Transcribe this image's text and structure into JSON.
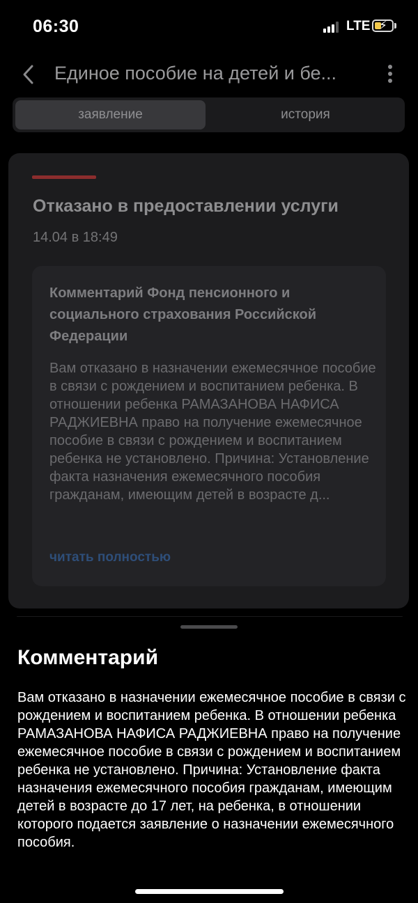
{
  "status_bar": {
    "time": "06:30",
    "network": "LTE",
    "signal_bars": 3,
    "battery_charging": true
  },
  "header": {
    "title": "Единое пособие на детей и бе...",
    "back_icon": "chevron-left-icon",
    "menu_icon": "more-vertical-icon"
  },
  "tabs": [
    {
      "label": "заявление",
      "active": true
    },
    {
      "label": "история",
      "active": false
    }
  ],
  "status_card": {
    "accent_color": "#8b2d2d",
    "title": "Отказано в предоставлении услуги",
    "date": "14.04 в 18:49",
    "comment": {
      "heading": "Комментарий Фонд пенсионного и социального страхования Российской Федерации",
      "text": "Вам отказано в назначении ежемесячное пособие в связи с рождением и воспитанием ребенка. В отношении ребенка РАМАЗАНОВА НАФИСА РАДЖИЕВНА право на получение ежемесячное пособие в связи с рождением и воспитанием ребенка не установлено. Причина: Установление факта назначения ежемесячного пособия гражданам, имеющим детей в возрасте д...",
      "read_more": "читать полностью",
      "read_more_color": "#2e4e79"
    }
  },
  "sheet": {
    "title": "Комментарий",
    "text": "Вам отказано в назначении ежемесячное пособие в связи с рождением и воспитанием ребенка. В отношении ребенка РАМАЗАНОВА НАФИСА РАДЖИЕВНА право на получение ежемесячное пособие в связи с рождением и воспитанием ребенка не установлено. Причина: Установление факта назначения ежемесячного пособия гражданам, имеющим детей в возрасте до 17 лет, на ребенка, в отношении которого подается заявление о назначении ежемесячного пособия."
  }
}
